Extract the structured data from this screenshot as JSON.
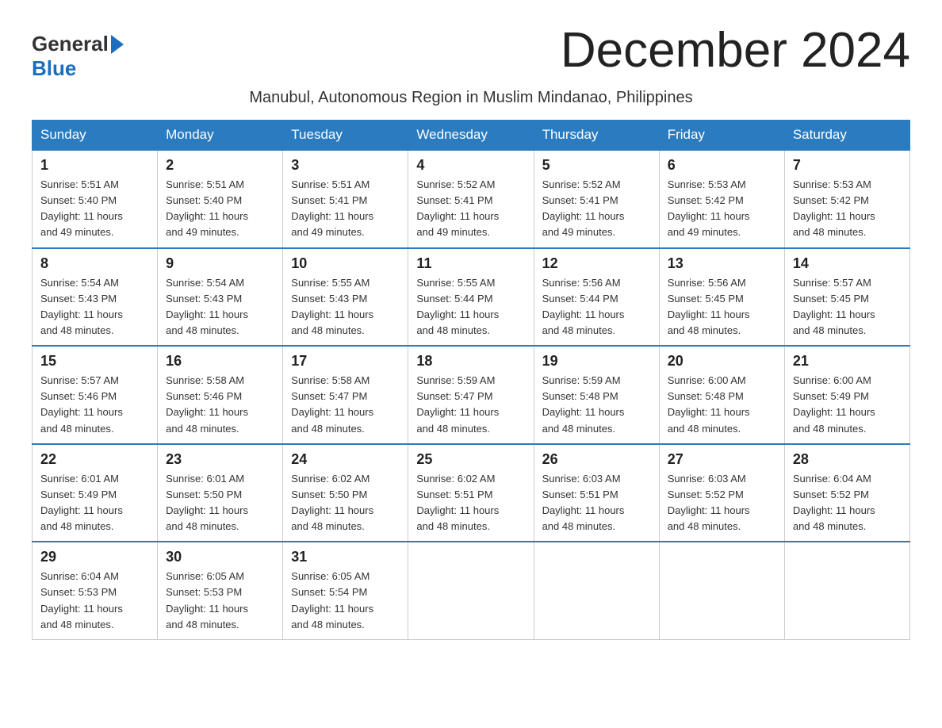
{
  "logo": {
    "text_general": "General",
    "triangle": "",
    "text_blue": "Blue"
  },
  "title": "December 2024",
  "subtitle": "Manubul, Autonomous Region in Muslim Mindanao, Philippines",
  "days_of_week": [
    "Sunday",
    "Monday",
    "Tuesday",
    "Wednesday",
    "Thursday",
    "Friday",
    "Saturday"
  ],
  "weeks": [
    [
      {
        "day": "1",
        "sunrise": "5:51 AM",
        "sunset": "5:40 PM",
        "daylight": "11 hours and 49 minutes."
      },
      {
        "day": "2",
        "sunrise": "5:51 AM",
        "sunset": "5:40 PM",
        "daylight": "11 hours and 49 minutes."
      },
      {
        "day": "3",
        "sunrise": "5:51 AM",
        "sunset": "5:41 PM",
        "daylight": "11 hours and 49 minutes."
      },
      {
        "day": "4",
        "sunrise": "5:52 AM",
        "sunset": "5:41 PM",
        "daylight": "11 hours and 49 minutes."
      },
      {
        "day": "5",
        "sunrise": "5:52 AM",
        "sunset": "5:41 PM",
        "daylight": "11 hours and 49 minutes."
      },
      {
        "day": "6",
        "sunrise": "5:53 AM",
        "sunset": "5:42 PM",
        "daylight": "11 hours and 49 minutes."
      },
      {
        "day": "7",
        "sunrise": "5:53 AM",
        "sunset": "5:42 PM",
        "daylight": "11 hours and 48 minutes."
      }
    ],
    [
      {
        "day": "8",
        "sunrise": "5:54 AM",
        "sunset": "5:43 PM",
        "daylight": "11 hours and 48 minutes."
      },
      {
        "day": "9",
        "sunrise": "5:54 AM",
        "sunset": "5:43 PM",
        "daylight": "11 hours and 48 minutes."
      },
      {
        "day": "10",
        "sunrise": "5:55 AM",
        "sunset": "5:43 PM",
        "daylight": "11 hours and 48 minutes."
      },
      {
        "day": "11",
        "sunrise": "5:55 AM",
        "sunset": "5:44 PM",
        "daylight": "11 hours and 48 minutes."
      },
      {
        "day": "12",
        "sunrise": "5:56 AM",
        "sunset": "5:44 PM",
        "daylight": "11 hours and 48 minutes."
      },
      {
        "day": "13",
        "sunrise": "5:56 AM",
        "sunset": "5:45 PM",
        "daylight": "11 hours and 48 minutes."
      },
      {
        "day": "14",
        "sunrise": "5:57 AM",
        "sunset": "5:45 PM",
        "daylight": "11 hours and 48 minutes."
      }
    ],
    [
      {
        "day": "15",
        "sunrise": "5:57 AM",
        "sunset": "5:46 PM",
        "daylight": "11 hours and 48 minutes."
      },
      {
        "day": "16",
        "sunrise": "5:58 AM",
        "sunset": "5:46 PM",
        "daylight": "11 hours and 48 minutes."
      },
      {
        "day": "17",
        "sunrise": "5:58 AM",
        "sunset": "5:47 PM",
        "daylight": "11 hours and 48 minutes."
      },
      {
        "day": "18",
        "sunrise": "5:59 AM",
        "sunset": "5:47 PM",
        "daylight": "11 hours and 48 minutes."
      },
      {
        "day": "19",
        "sunrise": "5:59 AM",
        "sunset": "5:48 PM",
        "daylight": "11 hours and 48 minutes."
      },
      {
        "day": "20",
        "sunrise": "6:00 AM",
        "sunset": "5:48 PM",
        "daylight": "11 hours and 48 minutes."
      },
      {
        "day": "21",
        "sunrise": "6:00 AM",
        "sunset": "5:49 PM",
        "daylight": "11 hours and 48 minutes."
      }
    ],
    [
      {
        "day": "22",
        "sunrise": "6:01 AM",
        "sunset": "5:49 PM",
        "daylight": "11 hours and 48 minutes."
      },
      {
        "day": "23",
        "sunrise": "6:01 AM",
        "sunset": "5:50 PM",
        "daylight": "11 hours and 48 minutes."
      },
      {
        "day": "24",
        "sunrise": "6:02 AM",
        "sunset": "5:50 PM",
        "daylight": "11 hours and 48 minutes."
      },
      {
        "day": "25",
        "sunrise": "6:02 AM",
        "sunset": "5:51 PM",
        "daylight": "11 hours and 48 minutes."
      },
      {
        "day": "26",
        "sunrise": "6:03 AM",
        "sunset": "5:51 PM",
        "daylight": "11 hours and 48 minutes."
      },
      {
        "day": "27",
        "sunrise": "6:03 AM",
        "sunset": "5:52 PM",
        "daylight": "11 hours and 48 minutes."
      },
      {
        "day": "28",
        "sunrise": "6:04 AM",
        "sunset": "5:52 PM",
        "daylight": "11 hours and 48 minutes."
      }
    ],
    [
      {
        "day": "29",
        "sunrise": "6:04 AM",
        "sunset": "5:53 PM",
        "daylight": "11 hours and 48 minutes."
      },
      {
        "day": "30",
        "sunrise": "6:05 AM",
        "sunset": "5:53 PM",
        "daylight": "11 hours and 48 minutes."
      },
      {
        "day": "31",
        "sunrise": "6:05 AM",
        "sunset": "5:54 PM",
        "daylight": "11 hours and 48 minutes."
      },
      null,
      null,
      null,
      null
    ]
  ]
}
